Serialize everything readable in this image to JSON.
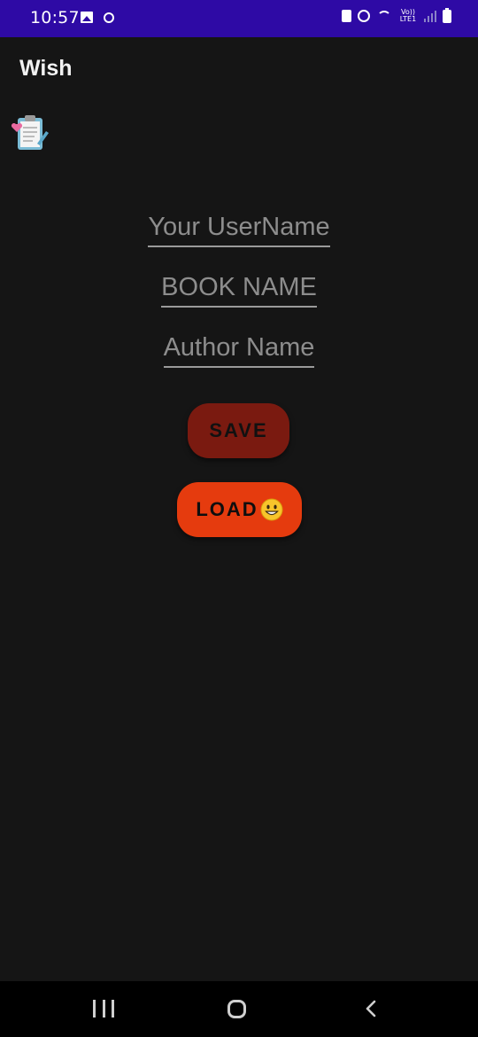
{
  "status_bar": {
    "time": "10:57",
    "volte_label": "Vo)) LTE1",
    "icons": [
      "gallery-icon",
      "circle-dot-icon",
      "lock-icon",
      "alarm-icon",
      "wifi-icon",
      "volte-icon",
      "signal-icon",
      "battery-icon"
    ]
  },
  "app": {
    "title": "Wish"
  },
  "header_icon": "clipboard-heart-icon",
  "form": {
    "username_placeholder": "Your UserName",
    "book_placeholder": "BOOK NAME",
    "author_placeholder": "Author Name"
  },
  "buttons": {
    "save_label": "SAVE",
    "load_label": "LOAD",
    "load_emoji": "grinning-face-emoji"
  },
  "nav": {
    "icons": [
      "recent-apps-icon",
      "home-icon",
      "back-icon"
    ]
  },
  "colors": {
    "status_bar": "#2e0aa5",
    "background": "#151515",
    "save_button": "#7a1a10",
    "load_button": "#e53b0e"
  }
}
